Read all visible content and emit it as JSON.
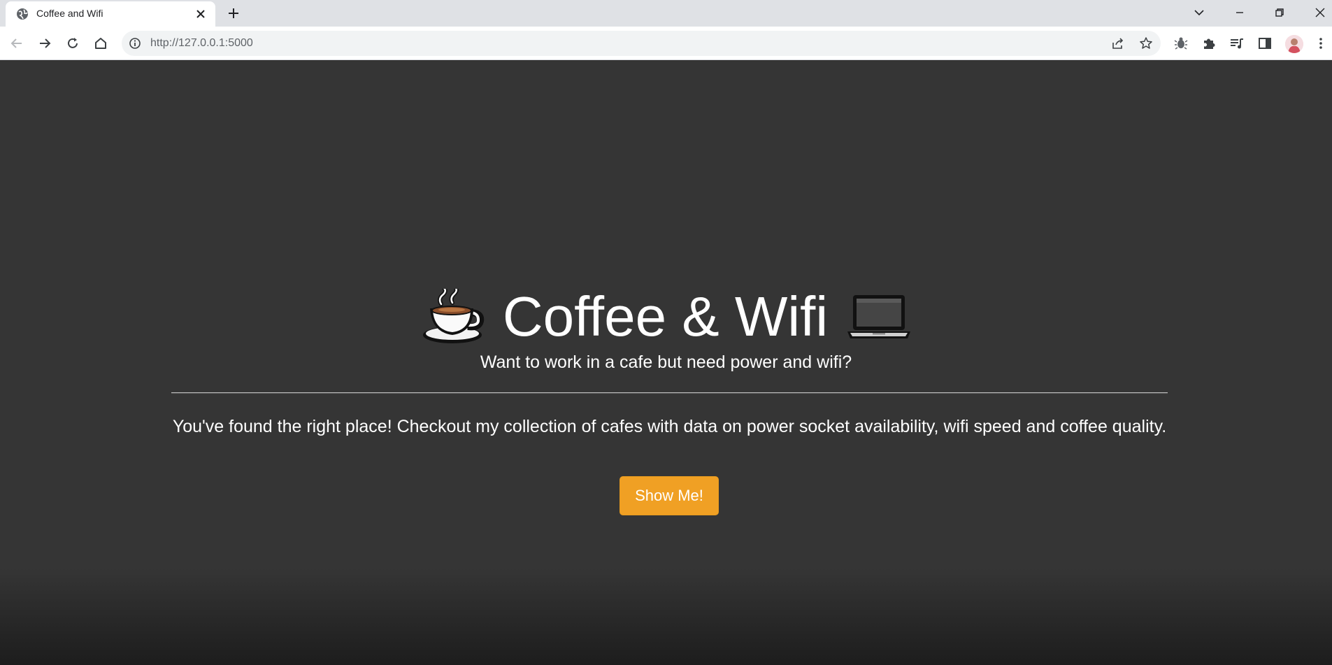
{
  "browser": {
    "tab": {
      "title": "Coffee and Wifi"
    },
    "address_bar": {
      "url": "http://127.0.0.1:5000"
    }
  },
  "page": {
    "title": "Coffee & Wifi",
    "title_icons": [
      "coffee-cup-icon",
      "laptop-icon"
    ],
    "subtitle": "Want to work in a cafe but need power and wifi?",
    "lead": "You've found the right place! Checkout my collection of cafes with data on power socket availability, wifi speed and coffee quality.",
    "cta_label": "Show Me!"
  },
  "colors": {
    "background": "#353535",
    "button": "#f0a024",
    "text": "#ffffff"
  }
}
